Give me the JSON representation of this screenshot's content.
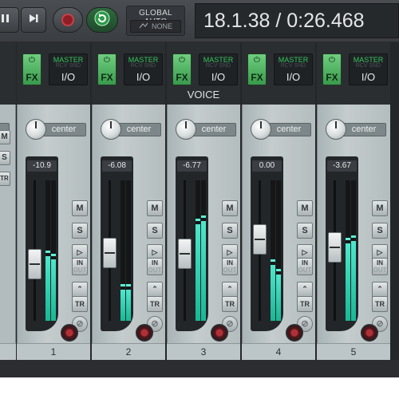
{
  "transport": {
    "pause_label": "⏸",
    "next_label": "⏭",
    "repeat_label": "⟳",
    "global_auto_label": "GLOBAL AUTO",
    "global_auto_value": "NONE",
    "time_display": "18.1.38 / 0:26.468"
  },
  "colors": {
    "fx_on": "#3fae55",
    "meter": "#22c9a6",
    "record": "#b03038"
  },
  "master": {
    "m_label": "M",
    "s_label": "S",
    "tr_label": "TR"
  },
  "tracks": [
    {
      "number": "1",
      "name": "",
      "fx": "FX",
      "route_top": "MASTER",
      "route_sub": "RCV SND",
      "route_io": "I/O",
      "pan": "center",
      "volume": "-10.9",
      "fader_level": 0.38,
      "meter_left": 0.46,
      "meter_right": 0.44,
      "mute": "M",
      "solo": "S",
      "in_label": "IN",
      "out_label": "OUT",
      "tr_label": "TR"
    },
    {
      "number": "2",
      "name": "",
      "fx": "FX",
      "route_top": "MASTER",
      "route_sub": "RCV SND",
      "route_io": "I/O",
      "pan": "center",
      "volume": "-6.08",
      "fader_level": 0.48,
      "meter_left": 0.22,
      "meter_right": 0.22,
      "mute": "M",
      "solo": "S",
      "in_label": "IN",
      "out_label": "OUT",
      "tr_label": "TR"
    },
    {
      "number": "3",
      "name": "VOICE",
      "fx": "FX",
      "route_top": "MASTER",
      "route_sub": "RCV SND",
      "route_io": "I/O",
      "pan": "center",
      "volume": "-6.77",
      "fader_level": 0.47,
      "meter_left": 0.69,
      "meter_right": 0.71,
      "mute": "M",
      "solo": "S",
      "in_label": "IN",
      "out_label": "OUT",
      "tr_label": "TR"
    },
    {
      "number": "4",
      "name": "",
      "fx": "FX",
      "route_top": "MASTER",
      "route_sub": "RCV SND",
      "route_io": "I/O",
      "pan": "center",
      "volume": "0.00",
      "fader_level": 0.6,
      "meter_left": 0.4,
      "meter_right": 0.33,
      "mute": "M",
      "solo": "S",
      "in_label": "IN",
      "out_label": "OUT",
      "tr_label": "TR"
    },
    {
      "number": "5",
      "name": "",
      "fx": "FX",
      "route_top": "MASTER",
      "route_sub": "RCV SND",
      "route_io": "I/O",
      "pan": "center",
      "volume": "-3.67",
      "fader_level": 0.53,
      "meter_left": 0.55,
      "meter_right": 0.57,
      "mute": "M",
      "solo": "S",
      "in_label": "IN",
      "out_label": "OUT",
      "tr_label": "TR"
    }
  ]
}
